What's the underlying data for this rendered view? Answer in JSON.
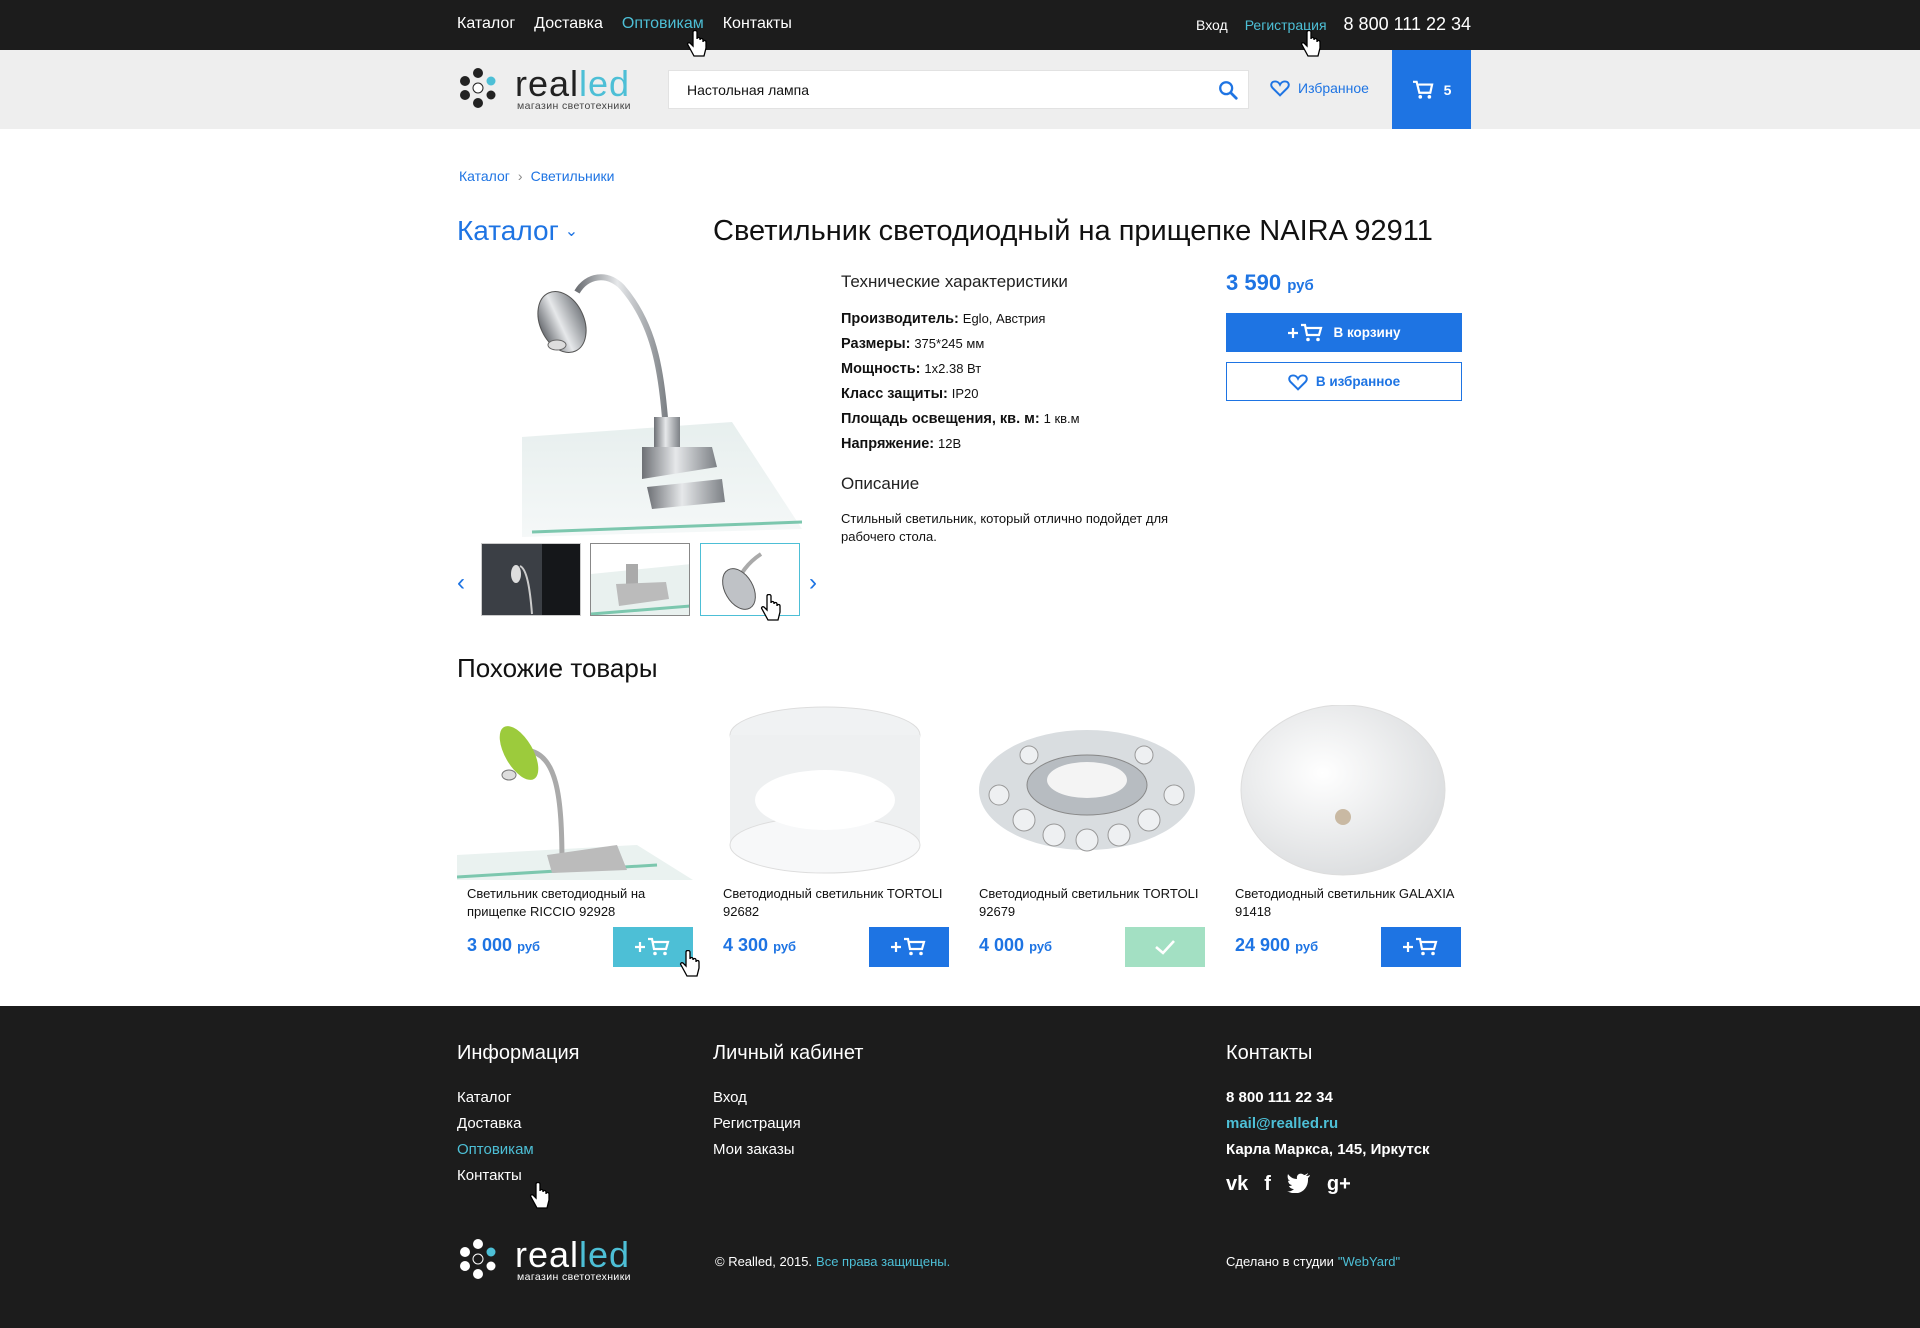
{
  "topbar": {
    "nav": [
      {
        "label": "Каталог",
        "active": false
      },
      {
        "label": "Доставка",
        "active": false
      },
      {
        "label": "Оптовикам",
        "active": true
      },
      {
        "label": "Контакты",
        "active": false
      }
    ],
    "login": "Вход",
    "register": "Регистрация",
    "phone": "8 800 111 22 34"
  },
  "brand": {
    "name_dark": "real",
    "name_accent": "led",
    "tagline": "магазин светотехники"
  },
  "header": {
    "search_value": "Настольная лампа",
    "search_icon": "search-icon",
    "favorites_label": "Избранное",
    "cart_count": "5"
  },
  "breadcrumb": [
    "Каталог",
    "Светильники"
  ],
  "catalog_title": "Каталог",
  "product": {
    "title": "Светильник светодиодный на прищепке NAIRA 92911",
    "specs_title": "Технические характеристики",
    "specs": [
      {
        "label": "Производитель:",
        "value": "Eglo, Австрия"
      },
      {
        "label": "Размеры:",
        "value": "375*245 мм"
      },
      {
        "label": "Мощность:",
        "value": "1x2.38 Вт"
      },
      {
        "label": "Класс защиты:",
        "value": "IP20"
      },
      {
        "label": "Площадь освещения, кв. м:",
        "value": "1 кв.м"
      },
      {
        "label": "Напряжение:",
        "value": "12В"
      }
    ],
    "description_title": "Описание",
    "description": "Стильный светильник, который отлично подойдет для рабочего стола.",
    "price": "3 590",
    "currency": "руб",
    "add_to_cart": "В корзину",
    "add_to_favorites": "В избранное"
  },
  "similar": {
    "title": "Похожие товары",
    "items": [
      {
        "name": "Светильник светодиодный на прищепке RICCIO 92928",
        "price": "3 000",
        "currency": "руб",
        "state": "hover"
      },
      {
        "name": "Светодиодный светильник TORTOLI 92682",
        "price": "4 300",
        "currency": "руб",
        "state": "normal"
      },
      {
        "name": "Светодиодный светильник TORTOLI 92679",
        "price": "4 000",
        "currency": "руб",
        "state": "added"
      },
      {
        "name": "Светодиодный светильник GALAXIA 91418",
        "price": "24 900",
        "currency": "руб",
        "state": "normal"
      }
    ]
  },
  "footer": {
    "info_title": "Информация",
    "info_links": [
      {
        "label": "Каталог",
        "active": false
      },
      {
        "label": "Доставка",
        "active": false
      },
      {
        "label": "Оптовикам",
        "active": true
      },
      {
        "label": "Контакты",
        "active": false
      }
    ],
    "account_title": "Личный кабинет",
    "account_links": [
      "Вход",
      "Регистрация",
      "Мои заказы"
    ],
    "contacts_title": "Контакты",
    "phone": "8 800 111 22 34",
    "email": "mail@realled.ru",
    "address": "Карла Маркса, 145, Иркутск",
    "socials": [
      "vk-icon",
      "facebook-icon",
      "twitter-icon",
      "google-plus-icon"
    ],
    "copyright": "© Realled, 2015.",
    "rights": "Все права защищены.",
    "studio_prefix": "Сделано в студии",
    "studio_name": "\"WebYard\""
  },
  "colors": {
    "accent_blue": "#1e74e3",
    "accent_cyan": "#4dbfd6",
    "dark_bg": "#1c1c1c",
    "added_green": "#a3e0c3"
  }
}
